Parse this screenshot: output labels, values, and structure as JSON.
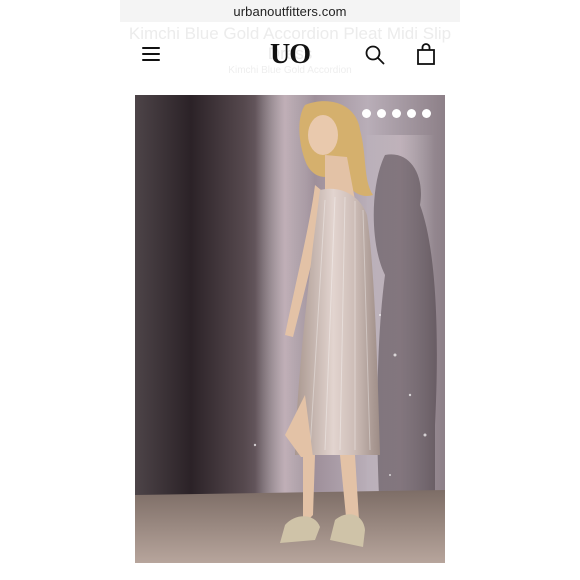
{
  "browser": {
    "url": "urbanoutfitters.com"
  },
  "header": {
    "logo_text": "UO",
    "behind_title": "Kimchi Blue Gold Accordion Pleat Midi Slip Dress",
    "behind_subtitle": "Kimchi Blue Gold Accordion"
  },
  "product": {
    "image_count": 5,
    "colors": {
      "dress": "#c9b8b4",
      "background": "#2b2227"
    }
  },
  "icons": [
    "menu-icon",
    "search-icon",
    "shopping-bag-icon"
  ]
}
